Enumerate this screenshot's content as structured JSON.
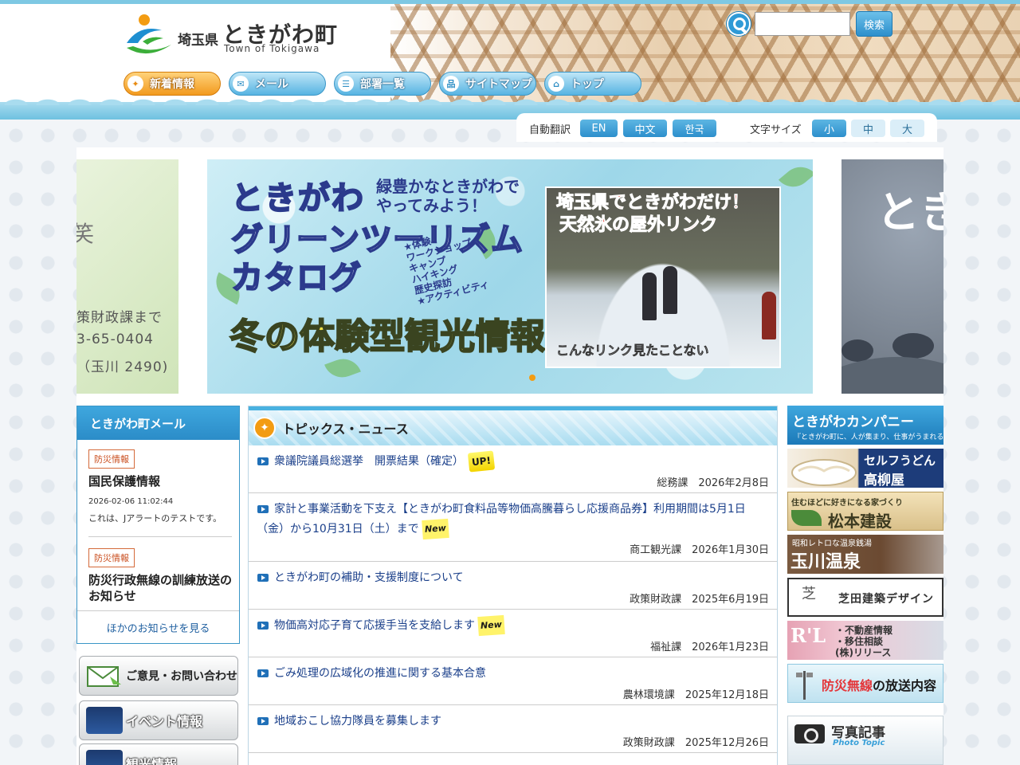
{
  "header": {
    "logo_pref": "埼玉県",
    "logo_name": "ときがわ町",
    "logo_en": "Town of Tokigawa",
    "search_placeholder": "",
    "search_button": "検索"
  },
  "nav": [
    {
      "label": "新着情報",
      "icon": "star-icon",
      "active": true
    },
    {
      "label": "メール",
      "icon": "mail-icon"
    },
    {
      "label": "部署一覧",
      "icon": "list-icon"
    },
    {
      "label": "サイトマップ",
      "icon": "sitemap-icon"
    },
    {
      "label": "トップ",
      "icon": "home-icon"
    }
  ],
  "util": {
    "translate_label": "自動翻訳",
    "langs": [
      "EN",
      "中文",
      "한국"
    ],
    "fontsize_label": "文字サイズ",
    "sizes": [
      "小",
      "中",
      "大"
    ]
  },
  "carousel": {
    "left_lines": [
      "策財政課まで",
      "3-65-0404",
      "（玉川 2490)"
    ],
    "left_char": "笑",
    "right_text": "とき",
    "main": {
      "title1": "ときがわ",
      "title2": "グリーンツーリズム",
      "title3": "カタログ",
      "sub1": "緑豊かなときがわで",
      "sub2": "やってみよう！",
      "list": [
        "★体験",
        "ワークショップ",
        "キャンプ",
        "ハイキング",
        "歴史探訪",
        "★アクティビティ"
      ],
      "winter": "冬の体験型観光情報",
      "photo_head1": "埼玉県でときがわだけ！",
      "photo_head2": "天然氷の屋外リンク",
      "photo_caption": "こんなリンク見たことない"
    }
  },
  "mail": {
    "title": "ときがわ町メール",
    "items": [
      {
        "badge": "防災情報",
        "title": "国民保護情報",
        "date": "2026-02-06 11:02:44",
        "body": "これは、Jアラートのテストです。"
      },
      {
        "badge": "防災情報",
        "title": "防災行政無線の訓練放送のお知らせ",
        "date": "",
        "body": ""
      }
    ],
    "more": "ほかのお知らせを見る"
  },
  "side_buttons": [
    {
      "label": "ご意見・お問い合わせ",
      "icon": "envelope-icon"
    },
    {
      "label": "イベント情報",
      "icon": "event-photo-icon"
    },
    {
      "label": "観光情報",
      "icon": "tourism-photo-icon"
    }
  ],
  "topics": {
    "title": "トピックス・ニュース",
    "items": [
      {
        "text": "衆議院議員総選挙　開票結果（確定）",
        "tag": "UP!",
        "dept": "総務課",
        "date": "2026年2月8日"
      },
      {
        "text_lines": [
          "家計と事業活動を下支え【ときがわ町食料品等物価高騰暮らし応援商品券】利用期間は5月1日",
          "（金）から10月31日（土）まで"
        ],
        "tag": "New",
        "dept": "商工観光課",
        "date": "2026年1月30日"
      },
      {
        "text": "ときがわ町の補助・支援制度について",
        "tag": "",
        "dept": "政策財政課",
        "date": "2025年6月19日"
      },
      {
        "text": "物価高対応子育て応援手当を支給します",
        "tag": "New",
        "dept": "福祉課",
        "date": "2026年1月23日"
      },
      {
        "text": "ごみ処理の広域化の推進に関する基本合意",
        "tag": "",
        "dept": "農林環境課",
        "date": "2025年12月18日"
      },
      {
        "text": "地域おこし協力隊員を募集します",
        "tag": "",
        "dept": "政策財政課",
        "date": "2025年12月26日"
      }
    ]
  },
  "banners": {
    "company_title": "ときがわカンパニー",
    "company_sub": "『ときがわ町に、人が集まり、仕事がうまれる』",
    "udon1": "セルフうどん",
    "udon2": "高柳屋",
    "matsumoto1": "住むほどに好きになる家づくり",
    "matsumoto2": "松本建設",
    "tamagawa1": "昭和レトロな温泉銭湯",
    "tamagawa2": "玉川温泉",
    "shibata_mark": "芝",
    "shibata": "芝田建築デザイン",
    "release_logo": "R'L",
    "release_lines": [
      "・不動産情報",
      "・移住相談",
      "(株)リリース"
    ],
    "bousai_red": "防災無線",
    "bousai_black": "の放送内容",
    "photo_title": "写真記事",
    "photo_sub": "Photo Topic"
  },
  "colors": {
    "accent_blue": "#2b8cc8",
    "accent_orange": "#f39c12",
    "link": "#1a3f8a"
  }
}
